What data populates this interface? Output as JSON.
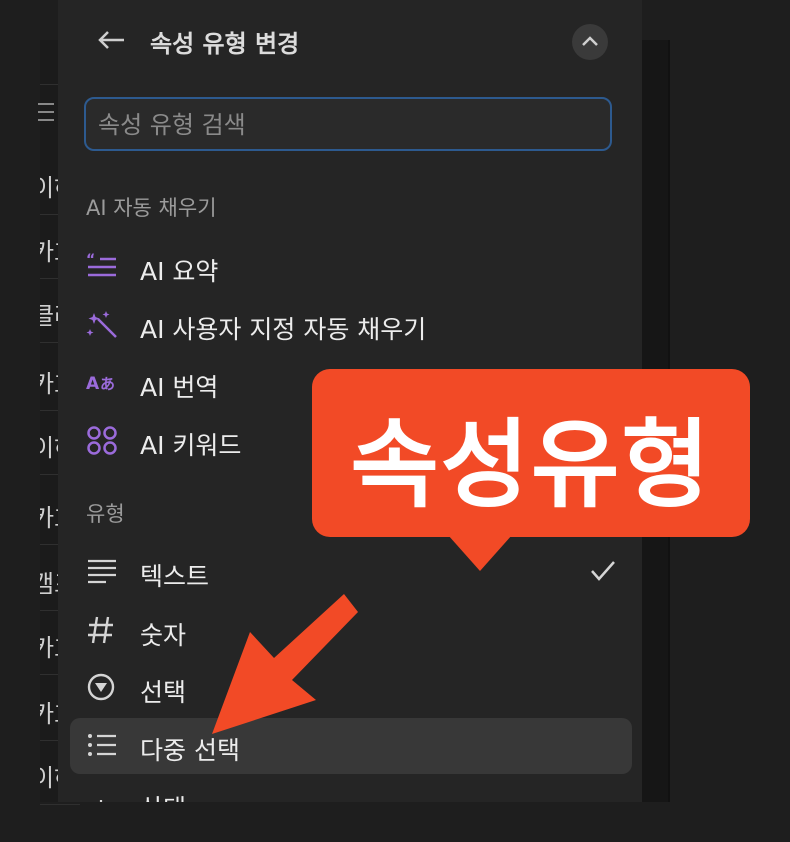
{
  "panel": {
    "title": "속성 유형 변경"
  },
  "search": {
    "placeholder": "속성 유형 검색"
  },
  "sections": {
    "ai_label": "AI 자동 채우기",
    "type_label": "유형"
  },
  "ai_items": [
    {
      "label": "AI 요약",
      "icon": "ai-summary-icon"
    },
    {
      "label": "AI 사용자 지정 자동 채우기",
      "icon": "magic-wand-icon"
    },
    {
      "label": "AI 번역",
      "icon": "translate-icon"
    },
    {
      "label": "AI 키워드",
      "icon": "keywords-icon"
    }
  ],
  "type_items": [
    {
      "label": "텍스트",
      "icon": "text-lines-icon",
      "selected": true
    },
    {
      "label": "숫자",
      "icon": "hash-icon"
    },
    {
      "label": "선택",
      "icon": "select-circle-icon"
    },
    {
      "label": "다중 선택",
      "icon": "bulleted-list-icon",
      "hovered": true
    },
    {
      "label": "상태",
      "icon": "status-icon"
    }
  ],
  "background_rows": [
    "이하",
    "카호",
    "클라",
    "카호",
    "이하",
    "카호",
    "캠프",
    "카호",
    "카호",
    "이하"
  ],
  "annotation": {
    "text": "속성유형"
  },
  "colors": {
    "accent_ai": "#9b6bdb",
    "focus_border": "#2d5a8f",
    "annotation": "#f24a26"
  }
}
